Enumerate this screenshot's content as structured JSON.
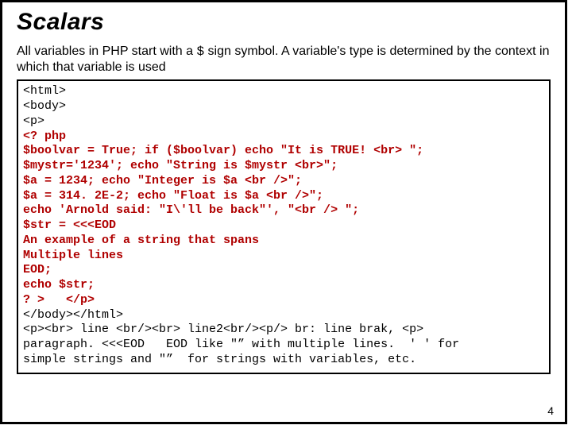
{
  "title": "Scalars",
  "intro_part1": "All variables in PHP start with a ",
  "intro_sym": "$",
  "intro_part2": " sign symbol. A variable's type is determined by the context in which that variable is used",
  "code": {
    "l1": "<html>",
    "l2": "<body>",
    "l3": "<p>",
    "l4": "<? php",
    "l5": "$boolvar = True; if ($boolvar) echo \"It is TRUE! <br> \";",
    "l6": "$mystr='1234'; echo \"String is $mystr <br>\";",
    "l7": "$a = 1234; echo \"Integer is $a <br />\";",
    "l8": "$a = 314. 2E-2; echo \"Float is $a <br />\";",
    "l9": "echo 'Arnold said: \"I\\'ll be back\"', \"<br /> \";",
    "l10": "$str = <<<EOD",
    "l11": "An example of a string that spans",
    "l12": "Multiple lines",
    "l13": "EOD;",
    "l14": "echo $str;",
    "l15": "? >   </p>",
    "l16": "</body></html>",
    "l17": "<p><br> line <br/><br> line2<br/><p/> br: line brak, <p>",
    "l18": "paragraph. <<<EOD   EOD like \"” with multiple lines.  ' ' for",
    "l19": "simple strings and \"”  for strings with variables, etc."
  },
  "pagenum": "4"
}
